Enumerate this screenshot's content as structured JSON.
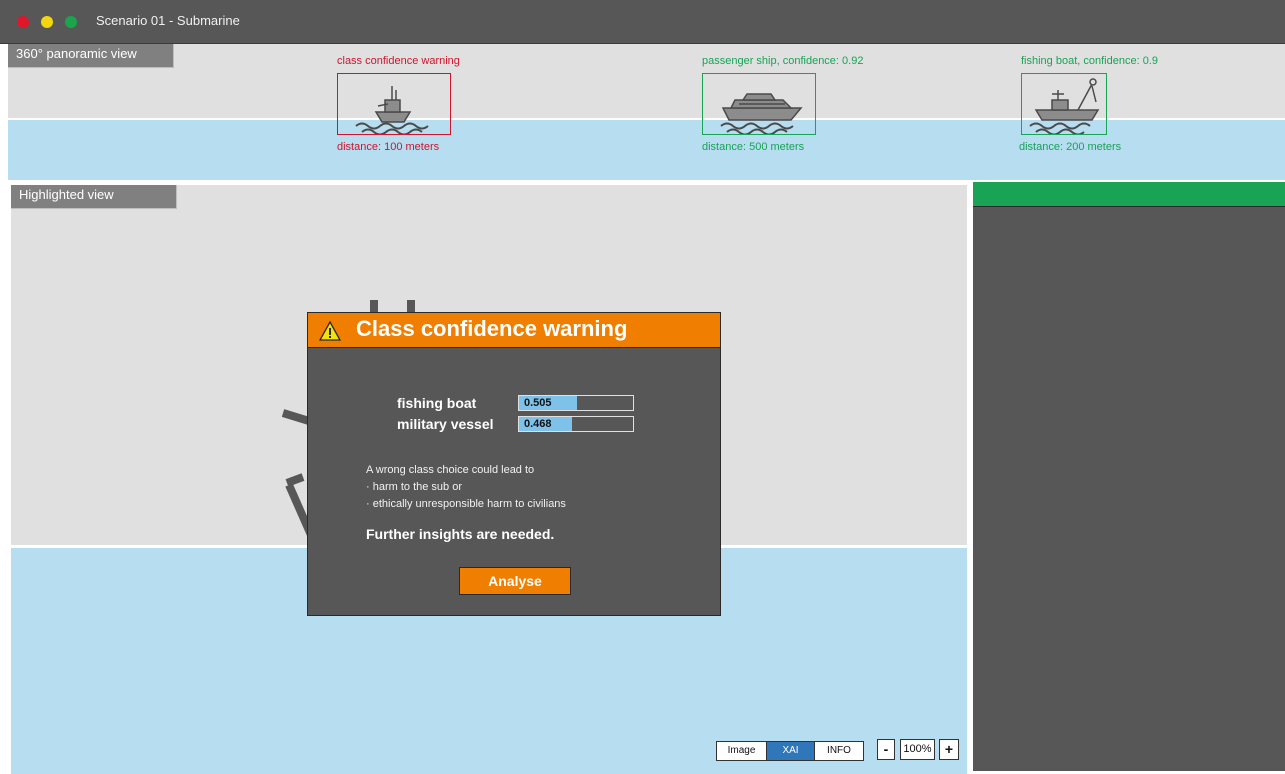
{
  "window": {
    "title": "Scenario 01 - Submarine",
    "controls": [
      {
        "name": "close",
        "color": "#e0162b"
      },
      {
        "name": "minimize",
        "color": "#f2d70e"
      },
      {
        "name": "maximize",
        "color": "#1aa54d"
      }
    ]
  },
  "panoramic": {
    "tab_label": "360° panoramic view",
    "detections": [
      {
        "label": "class confidence warning",
        "distance": "distance: 100 meters",
        "status": "warning",
        "color": "#d0142c",
        "icon": "military-vessel-icon"
      },
      {
        "label": "passenger ship, confidence: 0.92",
        "distance": "distance: 500 meters",
        "status": "ok",
        "color": "#18a355",
        "icon": "passenger-ship-icon"
      },
      {
        "label": "fishing boat, confidence: 0.9",
        "distance": "distance: 200 meters",
        "status": "ok",
        "color": "#18a355",
        "icon": "fishing-boat-icon"
      }
    ]
  },
  "highlighted": {
    "tab_label": "Highlighted view"
  },
  "view_controls": {
    "modes": [
      "Image",
      "XAI",
      "INFO"
    ],
    "active_mode": "XAI",
    "zoom_out": "-",
    "zoom_level": "100%",
    "zoom_in": "+"
  },
  "modal": {
    "title": "Class confidence warning",
    "icon": "warning-icon",
    "classes": [
      {
        "name": "fishing boat",
        "confidence": 0.505,
        "display": "0.505"
      },
      {
        "name": "military vessel",
        "confidence": 0.468,
        "display": "0.468"
      }
    ],
    "message_lines": [
      "A wrong class choice could lead to",
      "· harm to the sub or",
      "· ethically unresponsible harm to civilians"
    ],
    "emphasis": "Further insights are needed.",
    "action_label": "Analyse"
  },
  "colors": {
    "accent": "#f07e00",
    "water": "#b7ddf1",
    "panel": "#575757",
    "status_ok": "#18a355",
    "status_warning": "#d0142c"
  }
}
